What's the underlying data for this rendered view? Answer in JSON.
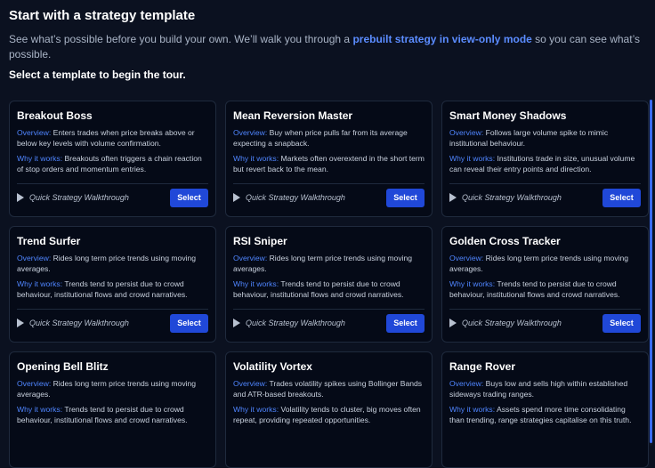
{
  "header": {
    "title": "Start with a strategy template",
    "intro_before": "See what’s possible before you build your own. We’ll walk you through a ",
    "intro_link": "prebuilt strategy in view-only mode",
    "intro_after": " so you can see what’s possible.",
    "prompt": "Select a template to begin the tour."
  },
  "labels": {
    "overview": "Overview:",
    "why": "Why it works:",
    "walkthrough": "Quick Strategy Walkthrough",
    "select": "Select"
  },
  "cards": [
    {
      "title": "Breakout Boss",
      "overview": "Enters trades when price breaks above or below key levels with volume confirmation.",
      "why": "Breakouts often triggers a chain reaction of stop orders and momentum entries."
    },
    {
      "title": "Mean Reversion Master",
      "overview": "Buy when price pulls far from its average expecting a snapback.",
      "why": "Markets often overextend in the short term but revert back to the mean."
    },
    {
      "title": "Smart Money Shadows",
      "overview": "Follows large volume spike to mimic institutional behaviour.",
      "why": "Institutions trade in size, unusual volume can reveal their entry points and direction."
    },
    {
      "title": "Trend Surfer",
      "overview": "Rides long term price trends using moving averages.",
      "why": "Trends tend to persist due to crowd behaviour, institutional flows and crowd narratives."
    },
    {
      "title": "RSI Sniper",
      "overview": "Rides long term price trends using moving averages.",
      "why": "Trends tend to persist due to crowd behaviour, institutional flows and crowd narratives."
    },
    {
      "title": "Golden Cross Tracker",
      "overview": "Rides long term price trends using moving averages.",
      "why": "Trends tend to persist due to crowd behaviour, institutional flows and crowd narratives."
    },
    {
      "title": "Opening Bell Blitz",
      "overview": "Rides long term price trends using moving averages.",
      "why": "Trends tend to persist due to crowd behaviour, institutional flows and crowd narratives."
    },
    {
      "title": "Volatility Vortex",
      "overview": "Trades volatility spikes using Bollinger Bands and ATR-based breakouts.",
      "why": "Volatility tends to cluster, big moves often repeat, providing repeated opportunities."
    },
    {
      "title": "Range Rover",
      "overview": "Buys low and sells high within established sideways trading ranges.",
      "why": "Assets spend more time consolidating than trending, range strategies capitalise on this truth."
    }
  ]
}
